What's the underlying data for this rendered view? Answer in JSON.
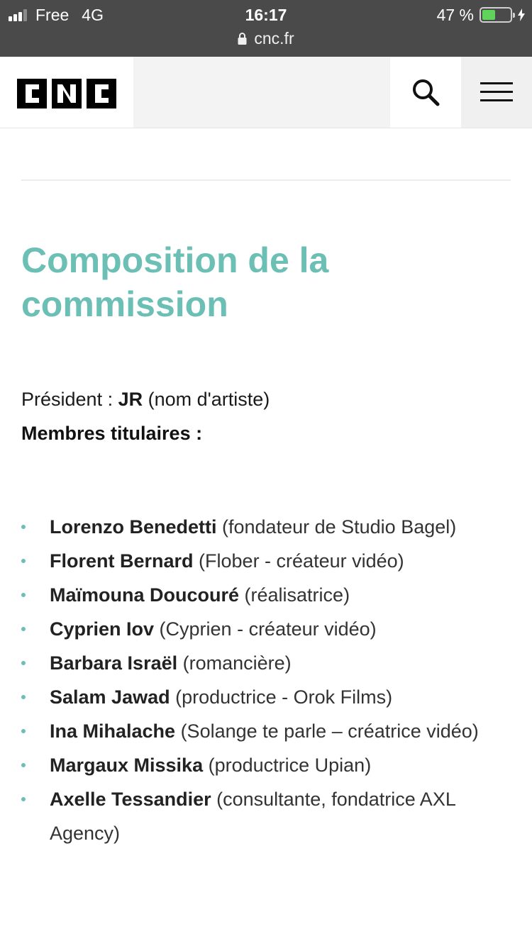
{
  "status_bar": {
    "carrier": "Free",
    "network": "4G",
    "time": "16:17",
    "battery_text": "47 %",
    "battery_level": 0.47,
    "signal_bars_on": 3,
    "signal_bars_total": 4
  },
  "browser": {
    "url": "cnc.fr"
  },
  "header": {
    "logo_text": "CNC",
    "search_icon": "search-icon",
    "menu_icon": "hamburger-menu-icon"
  },
  "content": {
    "title": "Composition de la commission",
    "president": {
      "label": "Président : ",
      "name": "JR",
      "note": " (nom d'artiste)"
    },
    "members_heading": "Membres titulaires :",
    "members": [
      {
        "name": "Lorenzo Benedetti",
        "role": " (fondateur de Studio Bagel)"
      },
      {
        "name": "Florent Bernard",
        "role": " (Flober - créateur vidéo)"
      },
      {
        "name": "Maïmouna Doucouré",
        "role": " (réalisatrice)"
      },
      {
        "name": "Cyprien Iov",
        "role": " (Cyprien - créateur vidéo)"
      },
      {
        "name": "Barbara Israël",
        "role": " (romancière)"
      },
      {
        "name": "Salam Jawad",
        "role": " (productrice - Orok Films)"
      },
      {
        "name": "Ina Mihalache",
        "role": " (Solange te parle – créatrice vidéo)"
      },
      {
        "name": "Margaux Missika",
        "role": " (productrice Upian)"
      },
      {
        "name": "Axelle Tessandier",
        "role": " (consultante, fondatrice AXL Agency)"
      }
    ]
  },
  "colors": {
    "accent": "#6cbfb4",
    "status_bar_bg": "#4a4a4a",
    "battery_fill": "#5fd35a"
  }
}
